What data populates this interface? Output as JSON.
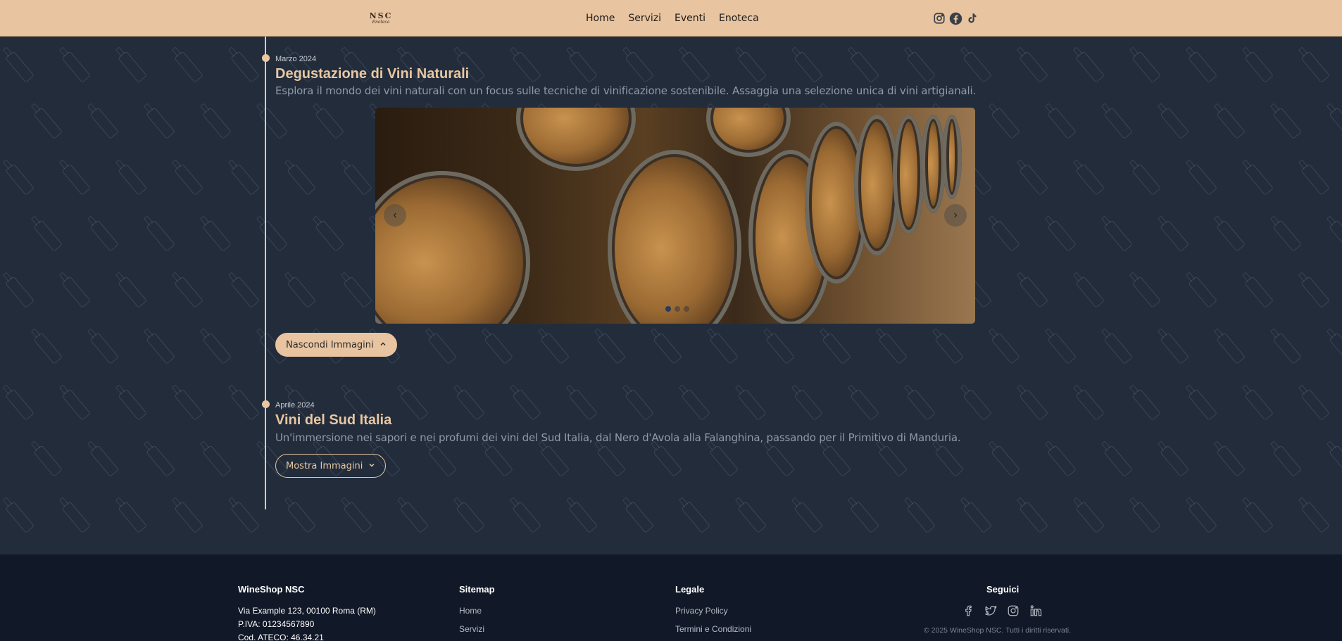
{
  "header": {
    "logo_line1": "NSC",
    "logo_line2": "Enoteca",
    "nav": [
      "Home",
      "Servizi",
      "Eventi",
      "Enoteca"
    ],
    "social_icons": [
      "instagram-icon",
      "facebook-icon",
      "tiktok-icon"
    ]
  },
  "events": [
    {
      "date": "Marzo 2024",
      "title": "Degustazione di Vini Naturali",
      "description": "Esplora il mondo dei vini naturali con un focus sulle tecniche di vinificazione sostenibile. Assaggia una selezione unica di vini artigianali.",
      "button_label": "Nascondi Immagini",
      "carousel": {
        "slides": 3,
        "active_slide": 1
      }
    },
    {
      "date": "Aprile 2024",
      "title": "Vini del Sud Italia",
      "description": "Un'immersione nei sapori e nei profumi dei vini del Sud Italia, dal Nero d'Avola alla Falanghina, passando per il Primitivo di Manduria.",
      "button_label": "Mostra Immagini"
    }
  ],
  "footer": {
    "brand": "WineShop NSC",
    "address": "Via Example 123, 00100 Roma (RM)",
    "piva": "P.IVA: 01234567890",
    "ateco": "Cod. ATECO: 46.34.21",
    "sitemap_title": "Sitemap",
    "sitemap": [
      "Home",
      "Servizi"
    ],
    "legal_title": "Legale",
    "legal": [
      "Privacy Policy",
      "Termini e Condizioni"
    ],
    "follow_title": "Seguici",
    "follow_icons": [
      "facebook-icon",
      "twitter-icon",
      "instagram-icon",
      "linkedin-icon"
    ],
    "copyright": "© 2025 WineShop NSC. Tutti i diritti riservati."
  },
  "colors": {
    "accent": "#e8c4a0",
    "background": "#222c3b",
    "footer": "#111827"
  }
}
